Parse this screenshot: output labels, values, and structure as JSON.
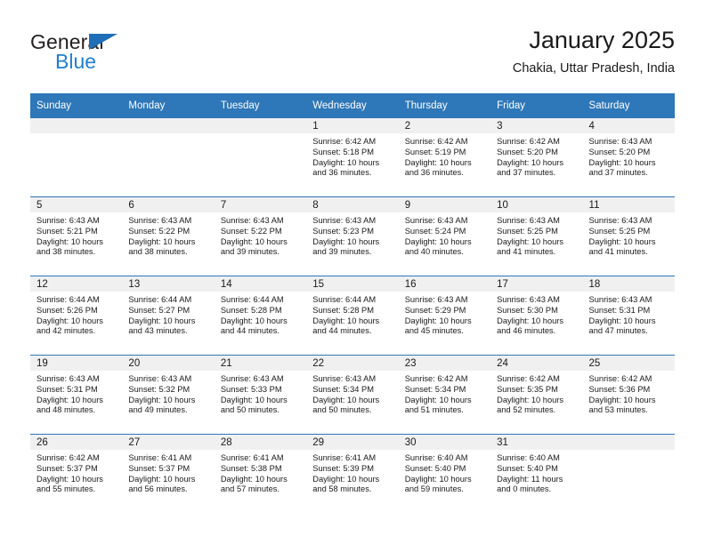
{
  "logo": {
    "word_one": "General",
    "word_two": "Blue",
    "triangle_color": "#1f6fb8",
    "word_two_color": "#1f7fd0"
  },
  "header": {
    "title": "January 2025",
    "subtitle": "Chakia, Uttar Pradesh, India"
  },
  "theme": {
    "header_bg": "#2e77b8",
    "header_text": "#ffffff",
    "daynum_bg": "#f0f0f0",
    "cell_bg": "#ffffff",
    "row_divider": "#2e77b8"
  },
  "weekdays": [
    "Sunday",
    "Monday",
    "Tuesday",
    "Wednesday",
    "Thursday",
    "Friday",
    "Saturday"
  ],
  "weeks": [
    [
      {
        "day": "",
        "lines": []
      },
      {
        "day": "",
        "lines": []
      },
      {
        "day": "",
        "lines": []
      },
      {
        "day": "1",
        "lines": [
          "Sunrise: 6:42 AM",
          "Sunset: 5:18 PM",
          "Daylight: 10 hours",
          "and 36 minutes."
        ]
      },
      {
        "day": "2",
        "lines": [
          "Sunrise: 6:42 AM",
          "Sunset: 5:19 PM",
          "Daylight: 10 hours",
          "and 36 minutes."
        ]
      },
      {
        "day": "3",
        "lines": [
          "Sunrise: 6:42 AM",
          "Sunset: 5:20 PM",
          "Daylight: 10 hours",
          "and 37 minutes."
        ]
      },
      {
        "day": "4",
        "lines": [
          "Sunrise: 6:43 AM",
          "Sunset: 5:20 PM",
          "Daylight: 10 hours",
          "and 37 minutes."
        ]
      }
    ],
    [
      {
        "day": "5",
        "lines": [
          "Sunrise: 6:43 AM",
          "Sunset: 5:21 PM",
          "Daylight: 10 hours",
          "and 38 minutes."
        ]
      },
      {
        "day": "6",
        "lines": [
          "Sunrise: 6:43 AM",
          "Sunset: 5:22 PM",
          "Daylight: 10 hours",
          "and 38 minutes."
        ]
      },
      {
        "day": "7",
        "lines": [
          "Sunrise: 6:43 AM",
          "Sunset: 5:22 PM",
          "Daylight: 10 hours",
          "and 39 minutes."
        ]
      },
      {
        "day": "8",
        "lines": [
          "Sunrise: 6:43 AM",
          "Sunset: 5:23 PM",
          "Daylight: 10 hours",
          "and 39 minutes."
        ]
      },
      {
        "day": "9",
        "lines": [
          "Sunrise: 6:43 AM",
          "Sunset: 5:24 PM",
          "Daylight: 10 hours",
          "and 40 minutes."
        ]
      },
      {
        "day": "10",
        "lines": [
          "Sunrise: 6:43 AM",
          "Sunset: 5:25 PM",
          "Daylight: 10 hours",
          "and 41 minutes."
        ]
      },
      {
        "day": "11",
        "lines": [
          "Sunrise: 6:43 AM",
          "Sunset: 5:25 PM",
          "Daylight: 10 hours",
          "and 41 minutes."
        ]
      }
    ],
    [
      {
        "day": "12",
        "lines": [
          "Sunrise: 6:44 AM",
          "Sunset: 5:26 PM",
          "Daylight: 10 hours",
          "and 42 minutes."
        ]
      },
      {
        "day": "13",
        "lines": [
          "Sunrise: 6:44 AM",
          "Sunset: 5:27 PM",
          "Daylight: 10 hours",
          "and 43 minutes."
        ]
      },
      {
        "day": "14",
        "lines": [
          "Sunrise: 6:44 AM",
          "Sunset: 5:28 PM",
          "Daylight: 10 hours",
          "and 44 minutes."
        ]
      },
      {
        "day": "15",
        "lines": [
          "Sunrise: 6:44 AM",
          "Sunset: 5:28 PM",
          "Daylight: 10 hours",
          "and 44 minutes."
        ]
      },
      {
        "day": "16",
        "lines": [
          "Sunrise: 6:43 AM",
          "Sunset: 5:29 PM",
          "Daylight: 10 hours",
          "and 45 minutes."
        ]
      },
      {
        "day": "17",
        "lines": [
          "Sunrise: 6:43 AM",
          "Sunset: 5:30 PM",
          "Daylight: 10 hours",
          "and 46 minutes."
        ]
      },
      {
        "day": "18",
        "lines": [
          "Sunrise: 6:43 AM",
          "Sunset: 5:31 PM",
          "Daylight: 10 hours",
          "and 47 minutes."
        ]
      }
    ],
    [
      {
        "day": "19",
        "lines": [
          "Sunrise: 6:43 AM",
          "Sunset: 5:31 PM",
          "Daylight: 10 hours",
          "and 48 minutes."
        ]
      },
      {
        "day": "20",
        "lines": [
          "Sunrise: 6:43 AM",
          "Sunset: 5:32 PM",
          "Daylight: 10 hours",
          "and 49 minutes."
        ]
      },
      {
        "day": "21",
        "lines": [
          "Sunrise: 6:43 AM",
          "Sunset: 5:33 PM",
          "Daylight: 10 hours",
          "and 50 minutes."
        ]
      },
      {
        "day": "22",
        "lines": [
          "Sunrise: 6:43 AM",
          "Sunset: 5:34 PM",
          "Daylight: 10 hours",
          "and 50 minutes."
        ]
      },
      {
        "day": "23",
        "lines": [
          "Sunrise: 6:42 AM",
          "Sunset: 5:34 PM",
          "Daylight: 10 hours",
          "and 51 minutes."
        ]
      },
      {
        "day": "24",
        "lines": [
          "Sunrise: 6:42 AM",
          "Sunset: 5:35 PM",
          "Daylight: 10 hours",
          "and 52 minutes."
        ]
      },
      {
        "day": "25",
        "lines": [
          "Sunrise: 6:42 AM",
          "Sunset: 5:36 PM",
          "Daylight: 10 hours",
          "and 53 minutes."
        ]
      }
    ],
    [
      {
        "day": "26",
        "lines": [
          "Sunrise: 6:42 AM",
          "Sunset: 5:37 PM",
          "Daylight: 10 hours",
          "and 55 minutes."
        ]
      },
      {
        "day": "27",
        "lines": [
          "Sunrise: 6:41 AM",
          "Sunset: 5:37 PM",
          "Daylight: 10 hours",
          "and 56 minutes."
        ]
      },
      {
        "day": "28",
        "lines": [
          "Sunrise: 6:41 AM",
          "Sunset: 5:38 PM",
          "Daylight: 10 hours",
          "and 57 minutes."
        ]
      },
      {
        "day": "29",
        "lines": [
          "Sunrise: 6:41 AM",
          "Sunset: 5:39 PM",
          "Daylight: 10 hours",
          "and 58 minutes."
        ]
      },
      {
        "day": "30",
        "lines": [
          "Sunrise: 6:40 AM",
          "Sunset: 5:40 PM",
          "Daylight: 10 hours",
          "and 59 minutes."
        ]
      },
      {
        "day": "31",
        "lines": [
          "Sunrise: 6:40 AM",
          "Sunset: 5:40 PM",
          "Daylight: 11 hours",
          "and 0 minutes."
        ]
      },
      {
        "day": "",
        "lines": []
      }
    ]
  ]
}
